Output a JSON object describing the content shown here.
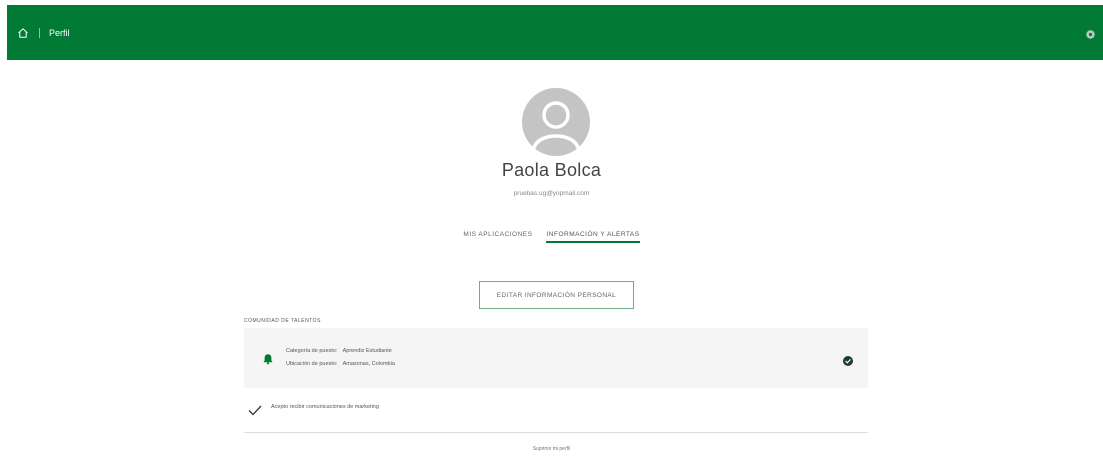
{
  "header": {
    "title": "Perfil",
    "home_icon": "home-icon",
    "settings_icon": "gear-icon",
    "background_color": "#017a36"
  },
  "profile": {
    "name": "Paola Bolca",
    "email": "pruebas.ug@yopmail.com",
    "avatar_icon": "user-avatar-icon"
  },
  "tabs": [
    {
      "label": "MIS APLICACIONES",
      "active": false
    },
    {
      "label": "INFORMACIÓN Y ALERTAS",
      "active": true
    }
  ],
  "edit_button": {
    "label": "EDITAR INFORMACIÓN PERSONAL"
  },
  "talent_community": {
    "title": "COMUNIDAD DE TALENTOS",
    "rows": [
      {
        "label": "Categoría de puesto:",
        "value": "Aprendiz Estudiante"
      },
      {
        "label": "Ubicación de puesto:",
        "value": "Amazonas, Colombia"
      }
    ],
    "icon": "bell-icon",
    "status_icon": "check-circle-icon"
  },
  "marketing": {
    "label": "Acepto recibir comunicaciones de marketing",
    "checked": true
  },
  "footer": {
    "delete_label": "Suprimir mi perfil"
  }
}
